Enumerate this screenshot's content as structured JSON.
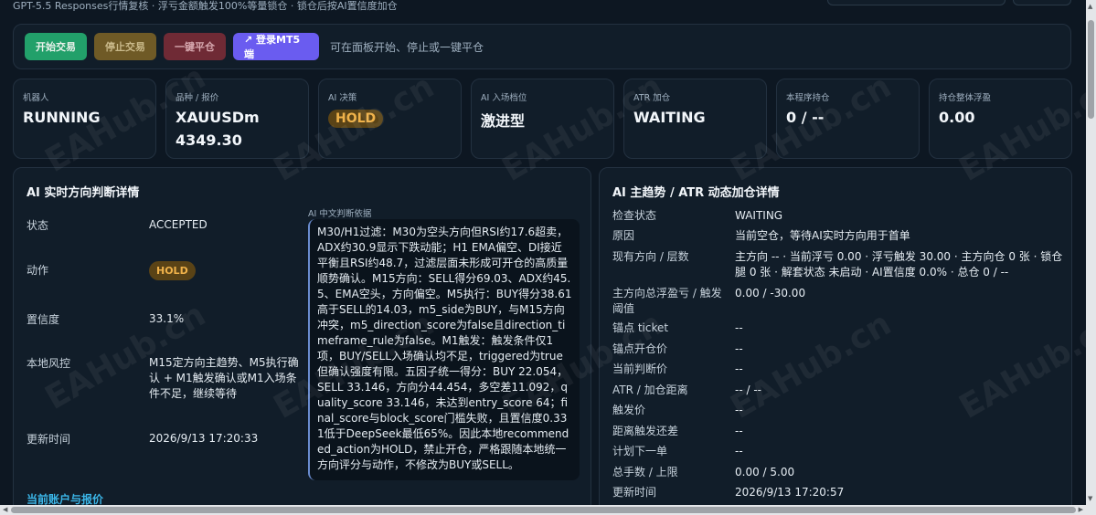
{
  "header": {
    "subtitle": "GPT-5.5 Responses行情复核 · 浮亏金额触发100%等量锁仓 · 锁仓后按AI置信度加仓"
  },
  "toolbar": {
    "start_label": "开始交易",
    "stop_label": "停止交易",
    "close_all_label": "一键平仓",
    "login_label": "↗ 登录MT5端",
    "hint": "可在面板开始、停止或一键平仓"
  },
  "stats": [
    {
      "label": "机器人",
      "value": "RUNNING"
    },
    {
      "label": "品种 / 报价",
      "value": "XAUUSDm",
      "sub": "4349.30"
    },
    {
      "label": "AI 决策",
      "value": "HOLD"
    },
    {
      "label": "AI 入场档位",
      "value": "激进型"
    },
    {
      "label": "ATR 加仓",
      "value": "WAITING"
    },
    {
      "label": "本程序持仓",
      "value": "0 / --"
    },
    {
      "label": "持仓整体浮盈",
      "value": "0.00"
    }
  ],
  "left_panel": {
    "title": "AI 实时方向判断详情",
    "rows": [
      {
        "label": "状态",
        "value": "ACCEPTED"
      },
      {
        "label": "动作",
        "value": "HOLD"
      },
      {
        "label": "置信度",
        "value": "33.1%"
      },
      {
        "label": "本地风控",
        "value": "M15定方向主趋势、M5执行确认 + M1触发确认或M1入场条件不足，继续等待"
      },
      {
        "label": "更新时间",
        "value": "2026/9/13 17:20:33"
      }
    ],
    "ai_basis_label": "AI 中文判断依据",
    "ai_basis_text": "M30/H1过滤：M30为空头方向但RSI约17.6超卖，ADX约30.9显示下跌动能；H1 EMA偏空、DI接近平衡且RSI约48.7，过滤层面未形成可开仓的高质量顺势确认。M15方向：SELL得分69.03、ADX约45.5、EMA空头，方向偏空。M5执行：BUY得分38.61高于SELL的14.03，m5_side为BUY，与M15方向冲突，m5_direction_score为false且direction_timeframe_rule为false。M1触发：触发条件仅1项，BUY/SELL入场确认均不足，triggered为true但确认强度有限。五因子统一得分：BUY 22.054，SELL 33.146，方向分44.454，多空差11.092，quality_score 33.146，未达到entry_score 64；final_score与block_score门槛失败，且置信度0.331低于DeepSeek最低65%。因此本地recommended_action为HOLD，禁止开仓，严格跟随本地统一方向评分与动作，不修改为BUY或SELL。",
    "section_link": "当前账户与报价"
  },
  "right_panel": {
    "title": "AI 主趋势 / ATR 动态加仓详情",
    "rows": [
      {
        "label": "检查状态",
        "value": "WAITING"
      },
      {
        "label": "原因",
        "value": "当前空仓，等待AI实时方向用于首单"
      },
      {
        "label": "现有方向 / 层数",
        "value": "主方向 -- · 当前浮亏 0.00 · 浮亏触发 30.00 · 主方向仓 0 张 · 锁仓腿 0 张 · 解套状态 未启动 · AI置信度 0.0% · 总仓 0 / --"
      },
      {
        "label": "主方向总浮盈亏 / 触发阈值",
        "value": "0.00 / -30.00"
      },
      {
        "label": "锚点 ticket",
        "value": "--"
      },
      {
        "label": "锚点开仓价",
        "value": "--"
      },
      {
        "label": "当前判断价",
        "value": "--"
      },
      {
        "label": "ATR / 加仓距离",
        "value": "-- / --"
      },
      {
        "label": "触发价",
        "value": "--"
      },
      {
        "label": "距离触发还差",
        "value": "--"
      },
      {
        "label": "计划下一单",
        "value": "--"
      },
      {
        "label": "总手数 / 上限",
        "value": "0.00 / 5.00"
      },
      {
        "label": "更新时间",
        "value": "2026/9/13 17:20:57"
      }
    ]
  },
  "watermark_text": "EAHub.cn",
  "colors": {
    "background": "#0d1722",
    "panel": "#111d29",
    "start": "#22a06a",
    "stop": "#6f5a26",
    "close": "#6f2a35",
    "login": "#6a5cf0",
    "hold": "#f0b24a",
    "link": "#3bb6e8"
  }
}
